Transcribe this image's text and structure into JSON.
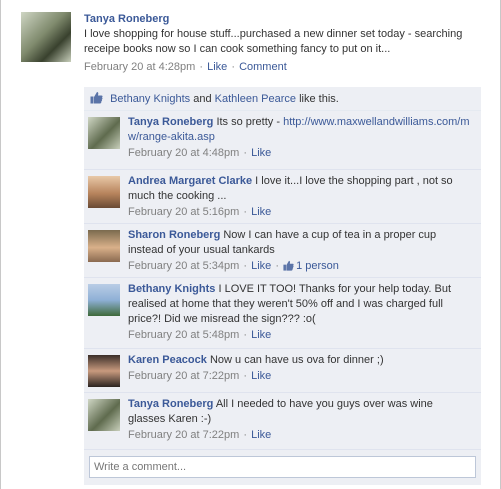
{
  "post": {
    "author": "Tanya Roneberg",
    "message": "I love shopping for house stuff...purchased a new dinner set today - searching receipe books now so I can cook something fancy to put on it...",
    "time": "February 20 at 4:28pm",
    "like_label": "Like",
    "comment_label": "Comment",
    "separator": "·"
  },
  "likes": {
    "names_1": "Bethany Knights",
    "and": "and",
    "names_2": "Kathleen Pearce",
    "suffix": "like this."
  },
  "comments": [
    {
      "author": "Tanya Roneberg",
      "text": "Its so pretty - ",
      "link": "http://www.maxwellandwilliams.com/mw/range-akita.asp",
      "time": "February 20 at 4:48pm",
      "like_label": "Like"
    },
    {
      "author": "Andrea Margaret Clarke",
      "text": "I love it...I love the shopping part , not so much the cooking ...",
      "time": "February 20 at 5:16pm",
      "like_label": "Like"
    },
    {
      "author": "Sharon Roneberg",
      "text": "Now I can have a cup of tea in a proper cup instead of your usual tankards",
      "time": "February 20 at 5:34pm",
      "like_label": "Like",
      "like_count": "1 person"
    },
    {
      "author": "Bethany Knights",
      "text": "I LOVE IT TOO! Thanks for your help today. But realised at home that they weren't 50% off and I was charged full price?! Did we misread the sign??? :o(",
      "time": "February 20 at 5:48pm",
      "like_label": "Like"
    },
    {
      "author": "Karen Peacock",
      "text": "Now u can have us ova for dinner ;)",
      "time": "February 20 at 7:22pm",
      "like_label": "Like"
    },
    {
      "author": "Tanya Roneberg",
      "text": "All I needed to have you guys over was wine glasses Karen :-)",
      "time": "February 20 at 7:22pm",
      "like_label": "Like"
    }
  ],
  "write_comment": {
    "placeholder": "Write a comment..."
  },
  "colors": {
    "link": "#3b5998",
    "ufi_bg": "#edeff4",
    "meta": "#808080"
  },
  "icons": {
    "like_thumb": "thumbs-up-icon"
  }
}
